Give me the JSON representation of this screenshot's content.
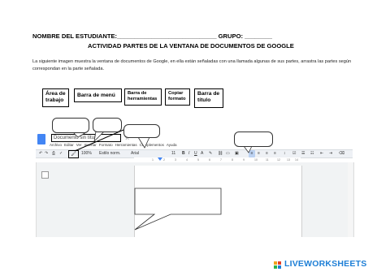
{
  "worksheet": {
    "header_line": "NOMBRE DEL ESTUDIANTE:_____________________________ GRUPO: ________",
    "subtitle": "ACTIVIDAD PARTES DE LA VENTANA DE DOCUMENTOS DE GOOGLE",
    "intro": "La siguiente imagen muestra la ventana de documentos de Google, en ella están señaladas con una llamada algunas de sus partes, arrastra las partes según correspondan en la parte señalada."
  },
  "answer_tags": [
    {
      "line1": "Área de",
      "line2": "trabajo"
    },
    {
      "line1": "Barra de menú",
      "line2": ""
    },
    {
      "line1": "Barra de",
      "line2": "herramientas"
    },
    {
      "line1": "Copiar",
      "line2": "formato"
    },
    {
      "line1": "Barra de",
      "line2": "título"
    }
  ],
  "gdocs": {
    "doc_title": "Documento sin título",
    "star": "☆",
    "menu": [
      "Archivo",
      "Editar",
      "Ver",
      "Insertar",
      "Formato",
      "Herramientas",
      "Complementos",
      "Ayuda"
    ],
    "toolbar": {
      "zoom": "100%",
      "style": "Estilo norm.",
      "font": "Arial",
      "size": "11"
    },
    "ruler_ticks": [
      "1",
      "2",
      "3",
      "4",
      "5",
      "6",
      "7",
      "8",
      "9",
      "10",
      "11",
      "12",
      "13",
      "14"
    ]
  },
  "logo": {
    "text": "LIVEWORKSHEETS",
    "color": "#1e7fd6"
  }
}
